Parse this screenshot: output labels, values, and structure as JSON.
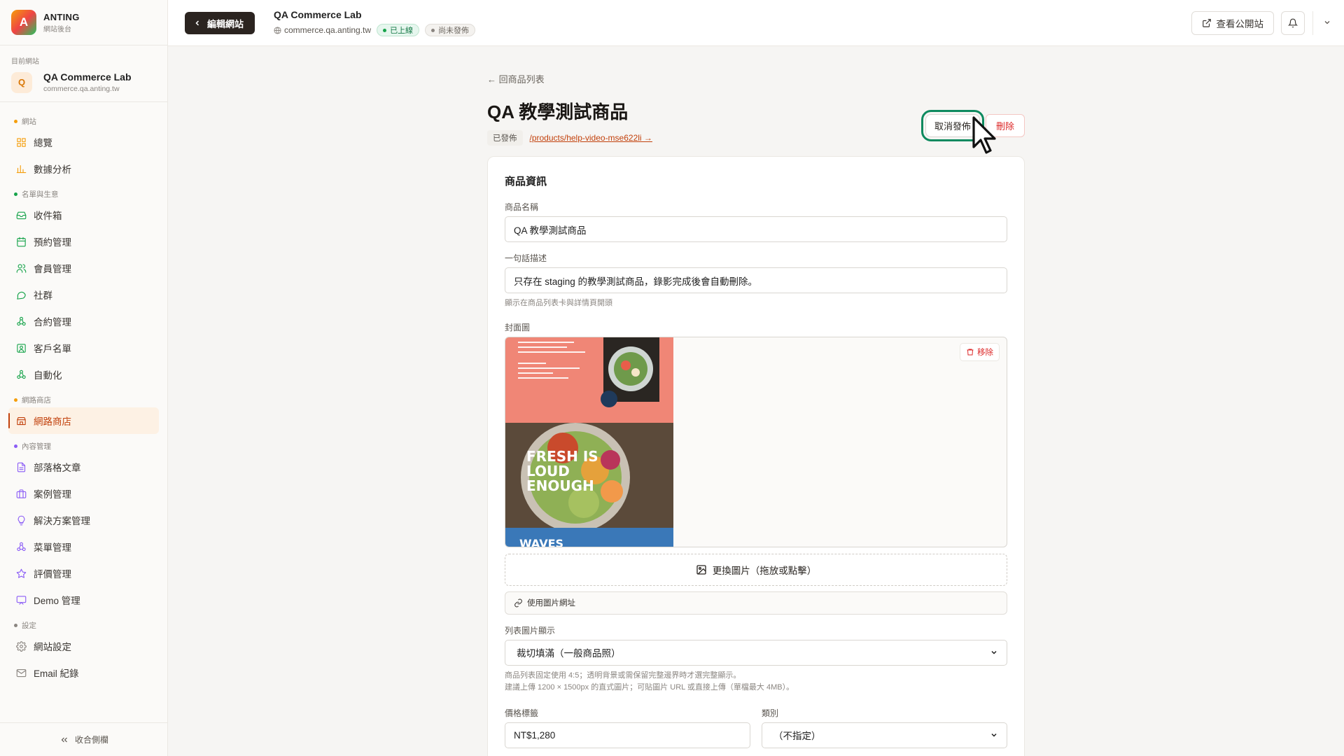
{
  "brand": {
    "logo_letter": "A",
    "name": "ANTING",
    "subtitle": "網站後台"
  },
  "current_site": {
    "label": "目前網站",
    "avatar_letter": "Q",
    "name": "QA Commerce Lab",
    "domain": "commerce.qa.anting.tw"
  },
  "nav": {
    "sections": [
      {
        "title": "網站",
        "color": "#f59e0b",
        "items": [
          {
            "label": "總覽",
            "icon": "grid-icon"
          },
          {
            "label": "數據分析",
            "icon": "bar-chart-icon"
          }
        ]
      },
      {
        "title": "名單與生意",
        "color": "#16a34a",
        "items": [
          {
            "label": "收件箱",
            "icon": "inbox-icon"
          },
          {
            "label": "預約管理",
            "icon": "calendar-icon"
          },
          {
            "label": "會員管理",
            "icon": "users-icon"
          },
          {
            "label": "社群",
            "icon": "chat-icon"
          },
          {
            "label": "合約管理",
            "icon": "workflow-icon"
          },
          {
            "label": "客戶名單",
            "icon": "contact-icon"
          },
          {
            "label": "自動化",
            "icon": "automation-icon"
          }
        ]
      },
      {
        "title": "網路商店",
        "color": "#f59e0b",
        "items": [
          {
            "label": "網路商店",
            "icon": "store-icon",
            "active": true
          }
        ]
      },
      {
        "title": "內容管理",
        "color": "#8b5cf6",
        "items": [
          {
            "label": "部落格文章",
            "icon": "document-icon"
          },
          {
            "label": "案例管理",
            "icon": "briefcase-icon"
          },
          {
            "label": "解決方案管理",
            "icon": "lightbulb-icon"
          },
          {
            "label": "菜單管理",
            "icon": "menu-tree-icon"
          },
          {
            "label": "評價管理",
            "icon": "star-icon"
          },
          {
            "label": "Demo 管理",
            "icon": "presentation-icon"
          }
        ]
      },
      {
        "title": "設定",
        "color": "#8a8580",
        "items": [
          {
            "label": "網站設定",
            "icon": "gear-icon"
          },
          {
            "label": "Email 紀錄",
            "icon": "mail-icon"
          }
        ]
      }
    ],
    "collapse_label": "收合側欄"
  },
  "topbar": {
    "edit_site_label": "編輯網站",
    "site_name": "QA Commerce Lab",
    "site_domain": "commerce.qa.anting.tw",
    "live_badge": "已上線",
    "unpublished_badge": "尚未發佈",
    "view_public_label": "查看公開站"
  },
  "page": {
    "back_label": "← 回商品列表",
    "title": "QA 教學測試商品",
    "status_chip": "已發佈",
    "slug_link": "/products/help-video-mse622li →",
    "unpublish_label": "取消發佈",
    "delete_label": "刪除"
  },
  "form": {
    "section_title": "商品資訊",
    "name_label": "商品名稱",
    "name_value": "QA 教學測試商品",
    "tagline_label": "一句話描述",
    "tagline_value": "只存在 staging 的教學測試商品，錄影完成後會自動刪除。",
    "tagline_hint": "顯示在商品列表卡與詳情頁開頭",
    "cover_label": "封面圖",
    "cover_remove_label": "移除",
    "cover_image_text": {
      "headline1": "FRESH IS",
      "headline2": "LOUD",
      "headline3": "ENOUGH",
      "footer": "WAVES"
    },
    "replace_image_label": "更換圖片（拖放或點擊）",
    "use_url_label": "使用圖片網址",
    "display_mode_label": "列表圖片顯示",
    "display_mode_value": "裁切填滿（一般商品照）",
    "display_hint_1": "商品列表固定使用 4:5；透明背景或需保留完整邊界時才選完整顯示。",
    "display_hint_2": "建議上傳 1200 × 1500px 的直式圖片；可貼圖片 URL 或直接上傳（單檔最大 4MB）。",
    "price_label": "價格標籤",
    "price_value": "NT$1,280",
    "category_label": "類別",
    "category_value": "（不指定）"
  },
  "colors": {
    "accent": "#c2410c",
    "focus_ring": "#0e8a5f",
    "danger": "#dc2626"
  }
}
